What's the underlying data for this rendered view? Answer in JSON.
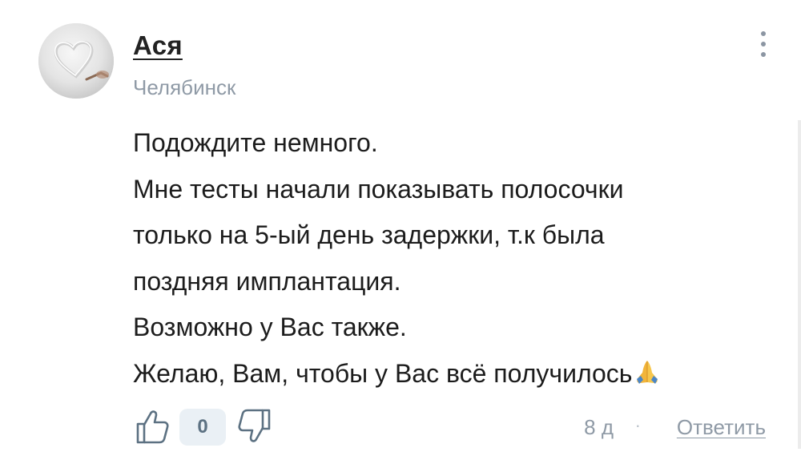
{
  "comment": {
    "author": "Ася",
    "city": "Челябинск",
    "lines": [
      "Подождите немного.",
      "Мне тесты начали показывать полосочки",
      "только на 5-ый день задержки, т.к была",
      "поздняя имплантация.",
      "Возможно у Вас также.",
      "Желаю, Вам, чтобы у Вас всё получилось"
    ],
    "emoji_icon": "folded-hands-emoji",
    "score": "0",
    "time": "8 д",
    "separator": "·",
    "reply_label": "Ответить"
  },
  "icons": {
    "like": "thumbs-up-icon",
    "dislike": "thumbs-down-icon",
    "menu": "more-vertical-icon"
  },
  "colors": {
    "text": "#1c1c1c",
    "muted": "#8f9aa6",
    "score_bg": "#eaf0f5",
    "icon": "#5c7182"
  }
}
